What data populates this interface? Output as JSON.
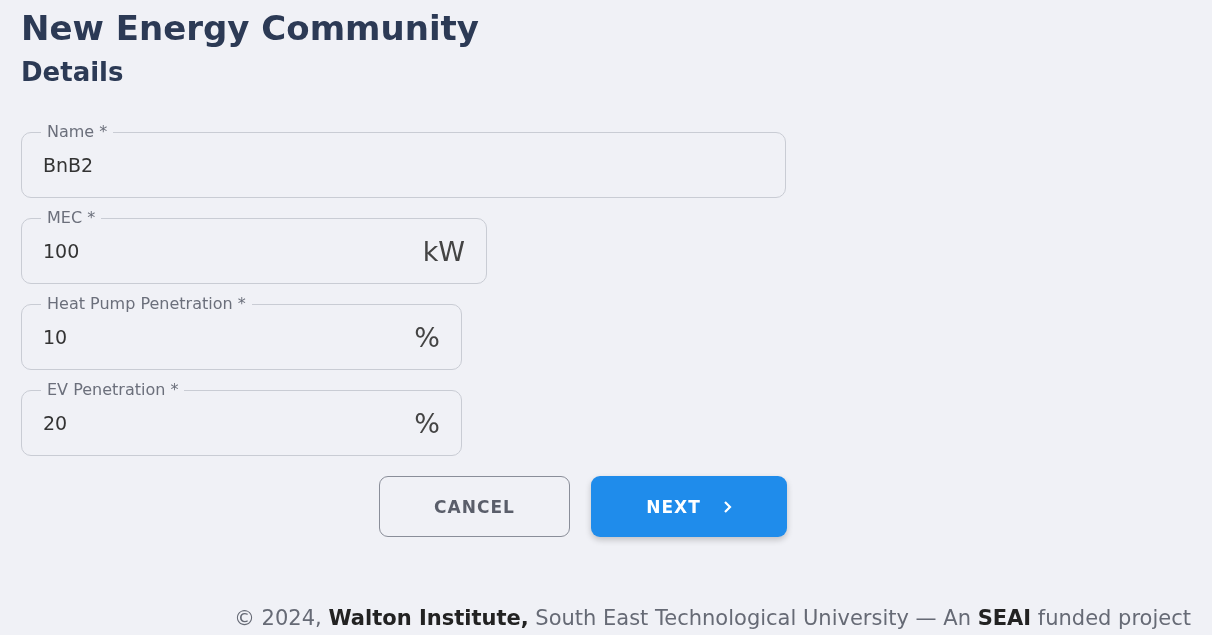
{
  "title": "New Energy Community",
  "subtitle": "Details",
  "fields": [
    {
      "label": "Name *",
      "value": "BnB2"
    },
    {
      "label": "MEC *",
      "value": "100",
      "unit": "kW"
    },
    {
      "label": "Heat Pump Penetration *",
      "value": "10",
      "unit": "%"
    },
    {
      "label": "EV Penetration *",
      "value": "20",
      "unit": "%"
    }
  ],
  "buttons": [
    {
      "label": "CANCEL",
      "kind": "outlined"
    },
    {
      "label": "NEXT",
      "kind": "primary"
    }
  ],
  "footer": "© 2024, **Walton Institute,** South East Technological University  —  An **SEAI** funded project"
}
